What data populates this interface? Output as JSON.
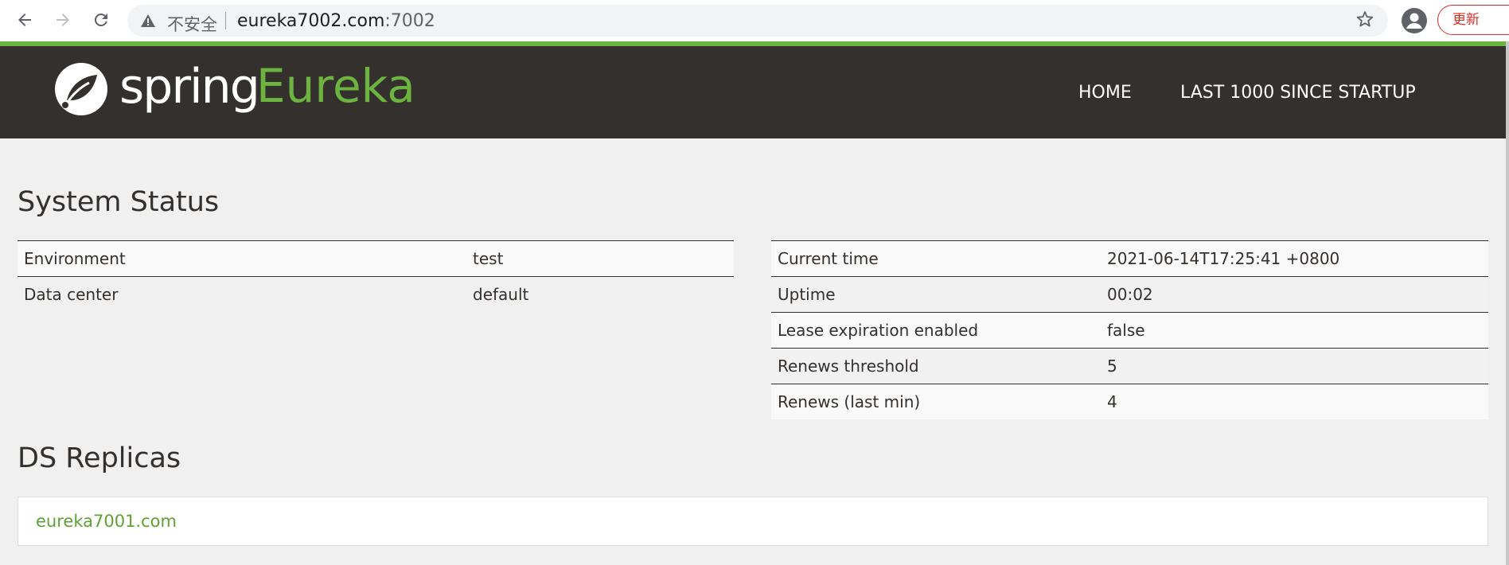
{
  "browser": {
    "insecure_label": "不安全",
    "url_host": "eureka7002.com",
    "url_port": ":7002",
    "update_label": "更新"
  },
  "header": {
    "logo_spring": "spring",
    "logo_eureka": "Eureka",
    "nav": [
      "HOME",
      "LAST 1000 SINCE STARTUP"
    ]
  },
  "system_status": {
    "title": "System Status",
    "left": [
      {
        "label": "Environment",
        "value": "test"
      },
      {
        "label": "Data center",
        "value": "default"
      }
    ],
    "right": [
      {
        "label": "Current time",
        "value": "2021-06-14T17:25:41 +0800"
      },
      {
        "label": "Uptime",
        "value": "00:02"
      },
      {
        "label": "Lease expiration enabled",
        "value": "false"
      },
      {
        "label": "Renews threshold",
        "value": "5"
      },
      {
        "label": "Renews (last min)",
        "value": "4"
      }
    ]
  },
  "ds_replicas": {
    "title": "DS Replicas",
    "items": [
      "eureka7001.com"
    ]
  },
  "colors": {
    "brand_green": "#6db33f",
    "header_bg": "#34302d",
    "update_red": "#d93025"
  }
}
